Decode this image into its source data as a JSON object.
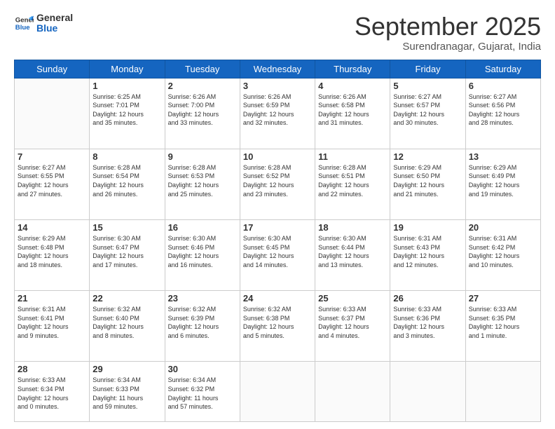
{
  "header": {
    "logo": {
      "line1": "General",
      "line2": "Blue"
    },
    "title": "September 2025",
    "subtitle": "Surendranagar, Gujarat, India"
  },
  "weekdays": [
    "Sunday",
    "Monday",
    "Tuesday",
    "Wednesday",
    "Thursday",
    "Friday",
    "Saturday"
  ],
  "weeks": [
    [
      {
        "day": "",
        "text": ""
      },
      {
        "day": "1",
        "text": "Sunrise: 6:25 AM\nSunset: 7:01 PM\nDaylight: 12 hours\nand 35 minutes."
      },
      {
        "day": "2",
        "text": "Sunrise: 6:26 AM\nSunset: 7:00 PM\nDaylight: 12 hours\nand 33 minutes."
      },
      {
        "day": "3",
        "text": "Sunrise: 6:26 AM\nSunset: 6:59 PM\nDaylight: 12 hours\nand 32 minutes."
      },
      {
        "day": "4",
        "text": "Sunrise: 6:26 AM\nSunset: 6:58 PM\nDaylight: 12 hours\nand 31 minutes."
      },
      {
        "day": "5",
        "text": "Sunrise: 6:27 AM\nSunset: 6:57 PM\nDaylight: 12 hours\nand 30 minutes."
      },
      {
        "day": "6",
        "text": "Sunrise: 6:27 AM\nSunset: 6:56 PM\nDaylight: 12 hours\nand 28 minutes."
      }
    ],
    [
      {
        "day": "7",
        "text": "Sunrise: 6:27 AM\nSunset: 6:55 PM\nDaylight: 12 hours\nand 27 minutes."
      },
      {
        "day": "8",
        "text": "Sunrise: 6:28 AM\nSunset: 6:54 PM\nDaylight: 12 hours\nand 26 minutes."
      },
      {
        "day": "9",
        "text": "Sunrise: 6:28 AM\nSunset: 6:53 PM\nDaylight: 12 hours\nand 25 minutes."
      },
      {
        "day": "10",
        "text": "Sunrise: 6:28 AM\nSunset: 6:52 PM\nDaylight: 12 hours\nand 23 minutes."
      },
      {
        "day": "11",
        "text": "Sunrise: 6:28 AM\nSunset: 6:51 PM\nDaylight: 12 hours\nand 22 minutes."
      },
      {
        "day": "12",
        "text": "Sunrise: 6:29 AM\nSunset: 6:50 PM\nDaylight: 12 hours\nand 21 minutes."
      },
      {
        "day": "13",
        "text": "Sunrise: 6:29 AM\nSunset: 6:49 PM\nDaylight: 12 hours\nand 19 minutes."
      }
    ],
    [
      {
        "day": "14",
        "text": "Sunrise: 6:29 AM\nSunset: 6:48 PM\nDaylight: 12 hours\nand 18 minutes."
      },
      {
        "day": "15",
        "text": "Sunrise: 6:30 AM\nSunset: 6:47 PM\nDaylight: 12 hours\nand 17 minutes."
      },
      {
        "day": "16",
        "text": "Sunrise: 6:30 AM\nSunset: 6:46 PM\nDaylight: 12 hours\nand 16 minutes."
      },
      {
        "day": "17",
        "text": "Sunrise: 6:30 AM\nSunset: 6:45 PM\nDaylight: 12 hours\nand 14 minutes."
      },
      {
        "day": "18",
        "text": "Sunrise: 6:30 AM\nSunset: 6:44 PM\nDaylight: 12 hours\nand 13 minutes."
      },
      {
        "day": "19",
        "text": "Sunrise: 6:31 AM\nSunset: 6:43 PM\nDaylight: 12 hours\nand 12 minutes."
      },
      {
        "day": "20",
        "text": "Sunrise: 6:31 AM\nSunset: 6:42 PM\nDaylight: 12 hours\nand 10 minutes."
      }
    ],
    [
      {
        "day": "21",
        "text": "Sunrise: 6:31 AM\nSunset: 6:41 PM\nDaylight: 12 hours\nand 9 minutes."
      },
      {
        "day": "22",
        "text": "Sunrise: 6:32 AM\nSunset: 6:40 PM\nDaylight: 12 hours\nand 8 minutes."
      },
      {
        "day": "23",
        "text": "Sunrise: 6:32 AM\nSunset: 6:39 PM\nDaylight: 12 hours\nand 6 minutes."
      },
      {
        "day": "24",
        "text": "Sunrise: 6:32 AM\nSunset: 6:38 PM\nDaylight: 12 hours\nand 5 minutes."
      },
      {
        "day": "25",
        "text": "Sunrise: 6:33 AM\nSunset: 6:37 PM\nDaylight: 12 hours\nand 4 minutes."
      },
      {
        "day": "26",
        "text": "Sunrise: 6:33 AM\nSunset: 6:36 PM\nDaylight: 12 hours\nand 3 minutes."
      },
      {
        "day": "27",
        "text": "Sunrise: 6:33 AM\nSunset: 6:35 PM\nDaylight: 12 hours\nand 1 minute."
      }
    ],
    [
      {
        "day": "28",
        "text": "Sunrise: 6:33 AM\nSunset: 6:34 PM\nDaylight: 12 hours\nand 0 minutes."
      },
      {
        "day": "29",
        "text": "Sunrise: 6:34 AM\nSunset: 6:33 PM\nDaylight: 11 hours\nand 59 minutes."
      },
      {
        "day": "30",
        "text": "Sunrise: 6:34 AM\nSunset: 6:32 PM\nDaylight: 11 hours\nand 57 minutes."
      },
      {
        "day": "",
        "text": ""
      },
      {
        "day": "",
        "text": ""
      },
      {
        "day": "",
        "text": ""
      },
      {
        "day": "",
        "text": ""
      }
    ]
  ]
}
